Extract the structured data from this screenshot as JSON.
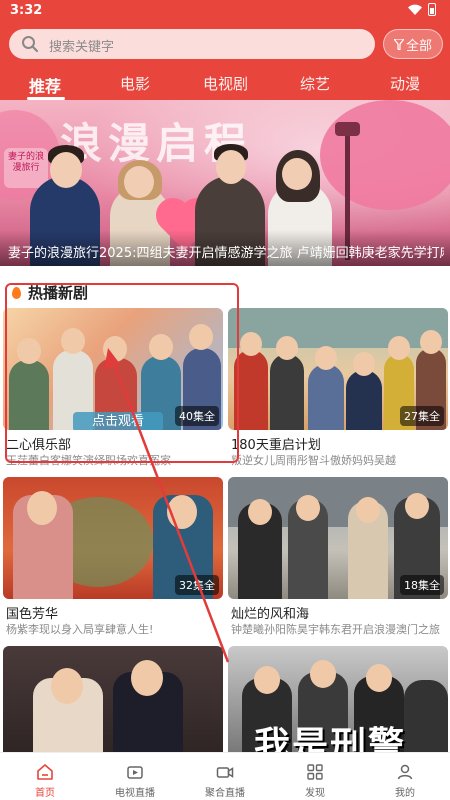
{
  "status_bar": {
    "time": "3:32"
  },
  "search": {
    "placeholder": "搜索关键字",
    "all_label": "全部"
  },
  "tabs": [
    {
      "label": "推荐",
      "active": true
    },
    {
      "label": "电影",
      "active": false
    },
    {
      "label": "电视剧",
      "active": false
    },
    {
      "label": "综艺",
      "active": false
    },
    {
      "label": "动漫",
      "active": false
    }
  ],
  "banner": {
    "title_art": "浪漫启程",
    "logo_text": "妻子的浪漫旅行",
    "caption": "妻子的浪漫旅行2025:四组夫妻开启情感游学之旅 卢靖姗回韩庚老家先学打麻将?",
    "active_dot": 2,
    "dot_count": 4
  },
  "section": {
    "title": "热播新剧"
  },
  "cards": [
    {
      "title": "二心俱乐部",
      "desc": "王茳蕾白客娜笑演绎职场欢喜冤家",
      "badge": "40集全",
      "overlay": "点击观看"
    },
    {
      "title": "180天重启计划",
      "desc": "叛逆女儿周雨彤智斗傲娇妈妈吴越",
      "badge": "27集全"
    },
    {
      "title": "国色芳华",
      "desc": "杨紫李现以身入局享肆意人生!",
      "badge": "32集全"
    },
    {
      "title": "灿烂的风和海",
      "desc": "钟楚曦孙阳陈昊宇韩东君开启浪漫澳门之旅",
      "badge": "18集全"
    },
    {
      "title": "",
      "desc": "",
      "badge": ""
    },
    {
      "title": "",
      "desc": "",
      "badge": "",
      "poster_text": "我是刑警"
    }
  ],
  "bottom_nav": [
    {
      "label": "首页",
      "icon": "home-icon",
      "active": true
    },
    {
      "label": "电视直播",
      "icon": "tv-icon",
      "active": false
    },
    {
      "label": "聚合直播",
      "icon": "video-camera-icon",
      "active": false
    },
    {
      "label": "发现",
      "icon": "grid-icon",
      "active": false
    },
    {
      "label": "我的",
      "icon": "user-icon",
      "active": false
    }
  ],
  "colors": {
    "brand": "#e8453c",
    "highlight": "#e23b3b"
  }
}
